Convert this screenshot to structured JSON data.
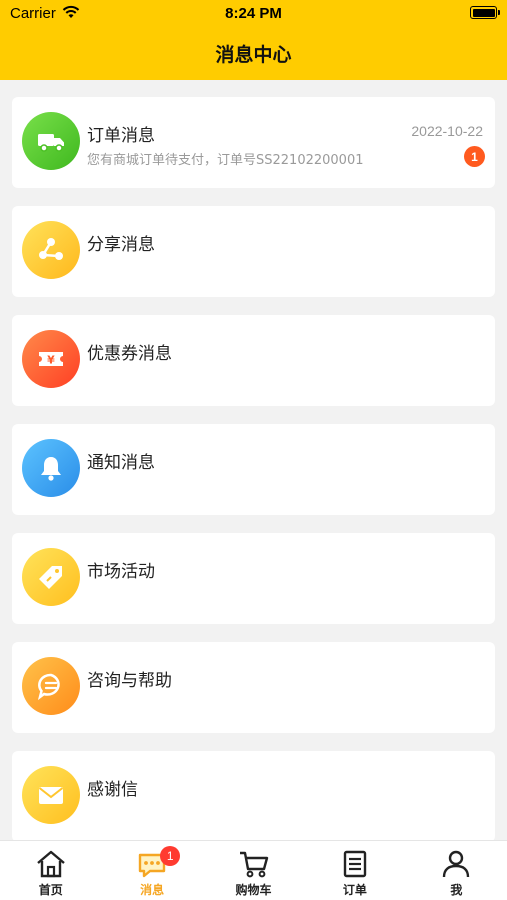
{
  "status": {
    "carrier": "Carrier",
    "time": "8:24 PM"
  },
  "header": {
    "title": "消息中心"
  },
  "messages": [
    {
      "title": "订单消息",
      "date": "2022-10-22",
      "subtitle": "您有商城订单待支付，订单号SS22102200001",
      "badge": "1",
      "icon": "truck-icon",
      "color": "#5ccd2e"
    },
    {
      "title": "分享消息",
      "icon": "share-icon",
      "color": "#ffc62e"
    },
    {
      "title": "优惠券消息",
      "icon": "coupon-icon",
      "color": "#ff6435"
    },
    {
      "title": "通知消息",
      "icon": "bell-icon",
      "color": "#3aa8f0"
    },
    {
      "title": "市场活动",
      "icon": "tag-icon",
      "color": "#ffcb2e"
    },
    {
      "title": "咨询与帮助",
      "icon": "chat-icon",
      "color": "#ffa52e"
    },
    {
      "title": "感谢信",
      "icon": "mail-icon",
      "color": "#ffcb2e"
    }
  ],
  "tabbar": {
    "items": [
      {
        "label": "首页",
        "icon": "home-icon"
      },
      {
        "label": "消息",
        "icon": "message-icon",
        "badge": "1",
        "active": true
      },
      {
        "label": "购物车",
        "icon": "cart-icon"
      },
      {
        "label": "订单",
        "icon": "order-list-icon"
      },
      {
        "label": "我",
        "icon": "user-icon"
      }
    ]
  },
  "colors": {
    "header": "#ffcc00",
    "active_tab": "#f5a623",
    "badge": "#ff3b30"
  }
}
